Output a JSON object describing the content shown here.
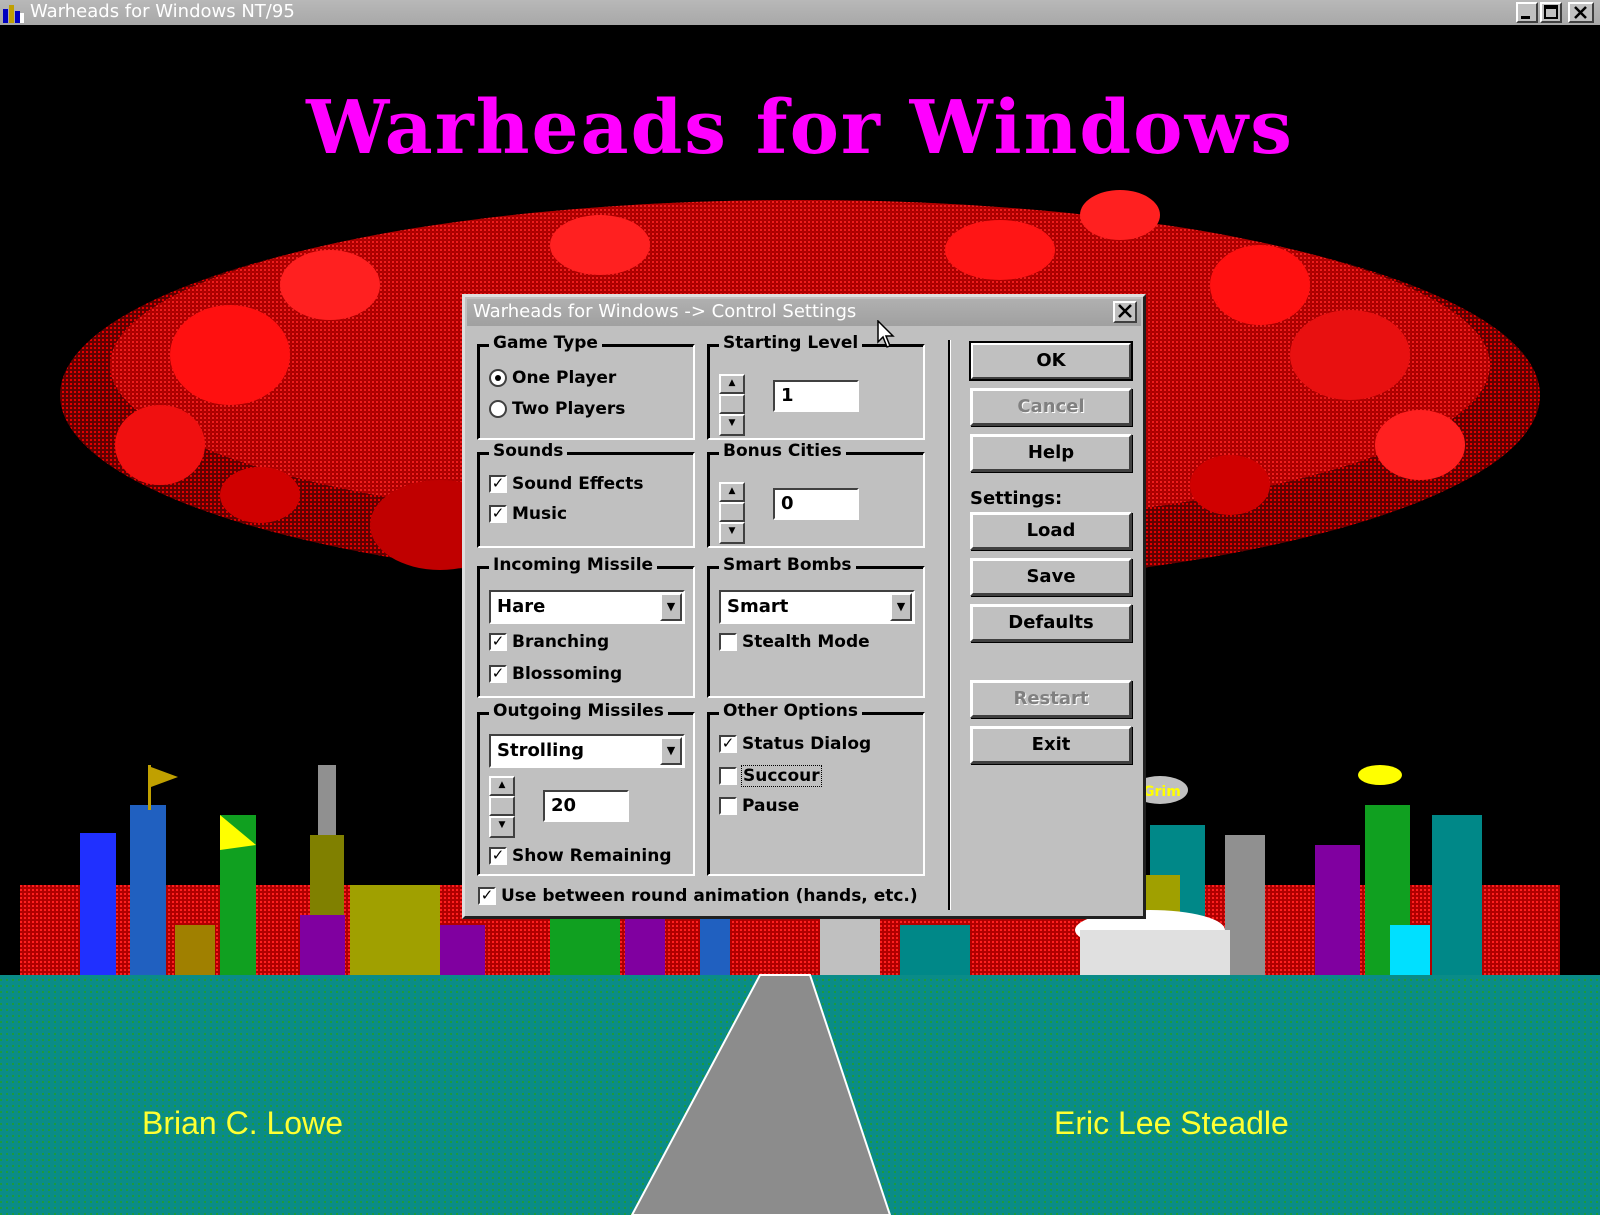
{
  "window": {
    "title": "Warheads for Windows NT/95"
  },
  "scene": {
    "headline": "Warheads for Windows",
    "credit_left": "Brian C. Lowe",
    "credit_right": "Eric Lee Steadle",
    "blimp_text": "Grim"
  },
  "dialog": {
    "title": "Warheads for Windows -> Control Settings",
    "game_type": {
      "label": "Game Type",
      "options": [
        "One Player",
        "Two Players"
      ],
      "selected": "One Player"
    },
    "starting_level": {
      "label": "Starting Level",
      "value": "1"
    },
    "sounds": {
      "label": "Sounds",
      "sound_effects": "Sound Effects",
      "music": "Music"
    },
    "bonus_cities": {
      "label": "Bonus Cities",
      "value": "0"
    },
    "incoming_missile": {
      "label": "Incoming Missile",
      "selected": "Hare",
      "branching": "Branching",
      "blossoming": "Blossoming"
    },
    "smart_bombs": {
      "label": "Smart Bombs",
      "selected": "Smart",
      "stealth_mode": "Stealth Mode"
    },
    "outgoing_missiles": {
      "label": "Outgoing Missiles",
      "selected": "Strolling",
      "count": "20",
      "show_remaining": "Show Remaining"
    },
    "other_options": {
      "label": "Other Options",
      "status_dialog": "Status Dialog",
      "succour": "Succour",
      "pause": "Pause"
    },
    "use_animation": "Use between round animation (hands, etc.)",
    "buttons": {
      "ok": "OK",
      "cancel": "Cancel",
      "help": "Help",
      "settings_label": "Settings:",
      "load": "Load",
      "save": "Save",
      "defaults": "Defaults",
      "restart": "Restart",
      "exit": "Exit"
    }
  },
  "colors": {
    "title_magenta": "#ff00ff",
    "credit_yellow": "#ffff33",
    "ground_teal": "#0a8c88",
    "cloud_red": "#e01010",
    "dialog_gray": "#c0c0c0"
  }
}
